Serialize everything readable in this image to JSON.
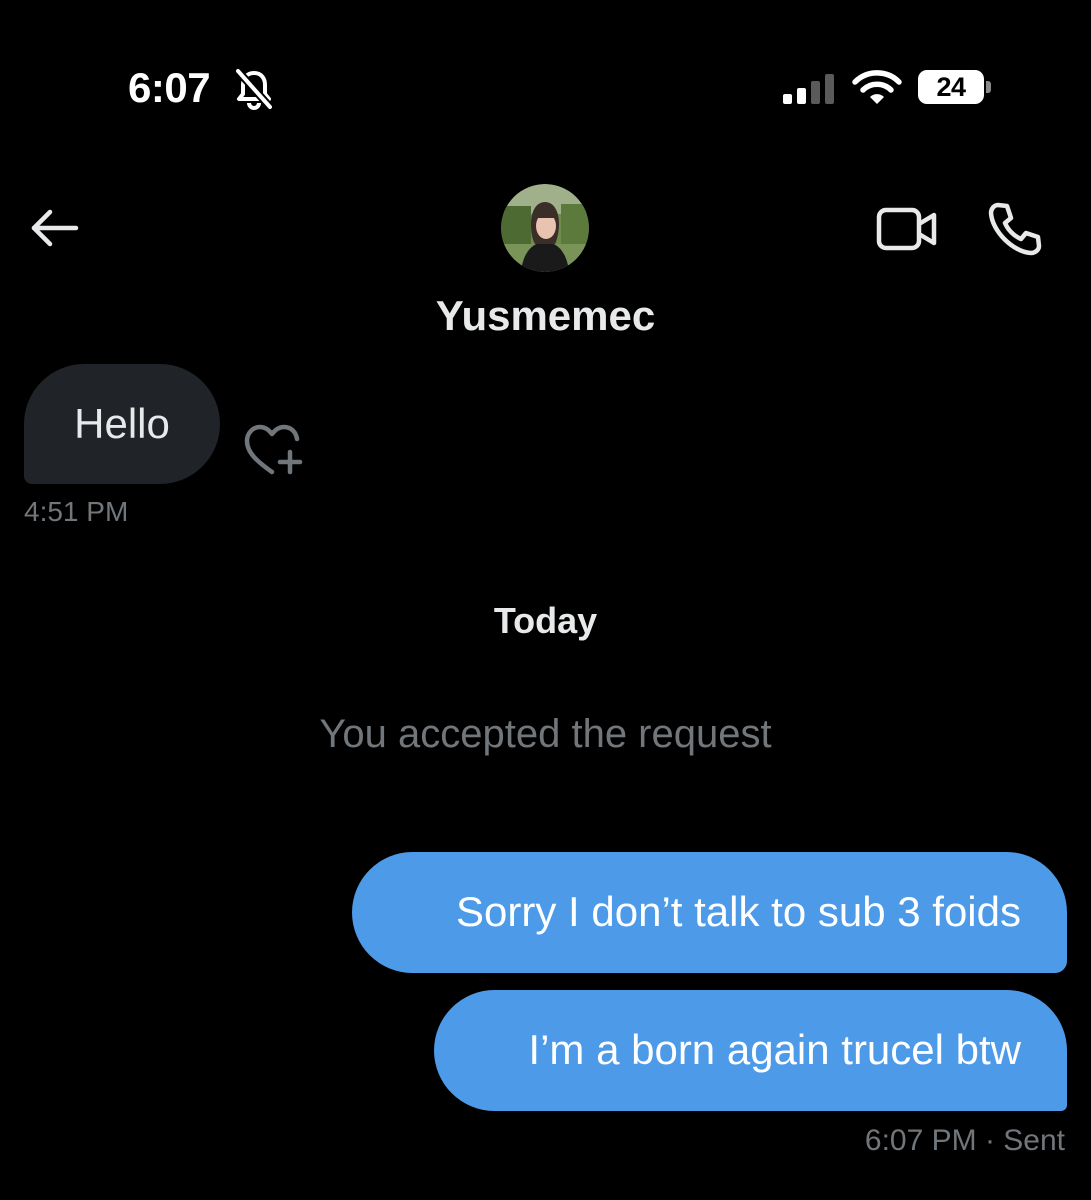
{
  "status_bar": {
    "time": "6:07",
    "battery": "24",
    "icons": [
      "bell-off-icon",
      "signal-icon",
      "wifi-icon",
      "battery-icon"
    ]
  },
  "header": {
    "contact_name": "Yusmemec",
    "icons": [
      "back-arrow-icon",
      "video-call-icon",
      "phone-call-icon"
    ]
  },
  "messages": {
    "received": [
      {
        "text": "Hello",
        "time": "4:51 PM"
      }
    ],
    "day_separator": "Today",
    "system_message": "You accepted the request",
    "sent": [
      {
        "text": "Sorry I don’t talk to sub 3 foids"
      },
      {
        "text": "I’m a born again trucel btw"
      }
    ],
    "sent_meta": "6:07 PM · Sent"
  },
  "colors": {
    "background": "#000000",
    "sent_bubble": "#4c9ae8",
    "received_bubble": "#202327",
    "muted_text": "#71767b"
  }
}
